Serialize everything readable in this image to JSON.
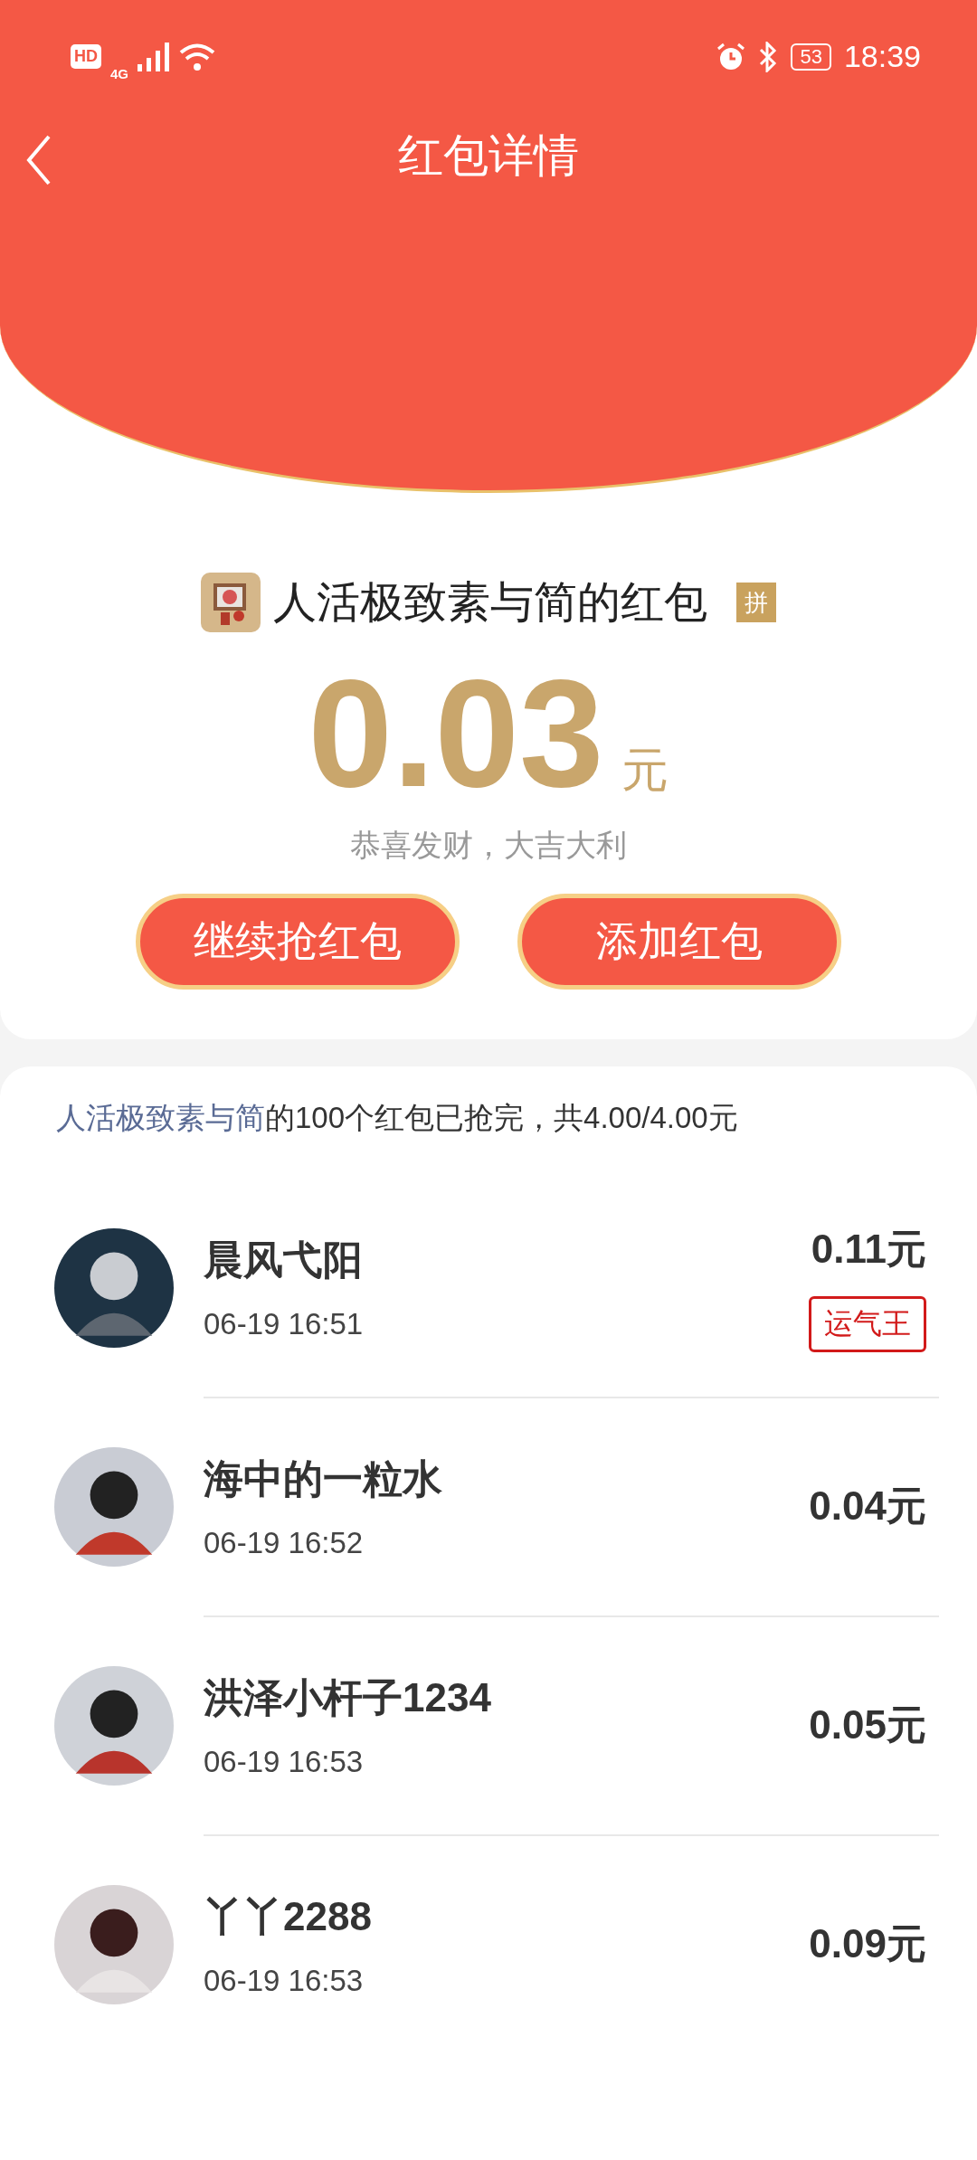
{
  "status_bar": {
    "hd": "HD",
    "network": "4G",
    "battery": "53",
    "time": "18:39"
  },
  "header": {
    "title": "红包详情"
  },
  "sender": {
    "title": "人活极致素与简的红包",
    "tag": "拼"
  },
  "amount": {
    "value": "0.03",
    "unit": "元"
  },
  "greeting": "恭喜发财，大吉大利",
  "buttons": [
    "继续抢红包",
    "添加红包"
  ],
  "summary": {
    "sender_name": "人活极致素与简",
    "text": "的100个红包已抢完，共4.00/4.00元"
  },
  "rows": [
    {
      "name": "晨风弋阳",
      "time": "06-19 16:51",
      "amount": "0.11元",
      "badge": "运气王"
    },
    {
      "name": "海中的一粒水",
      "time": "06-19 16:52",
      "amount": "0.04元"
    },
    {
      "name": "洪泽小杆子1234",
      "time": "06-19 16:53",
      "amount": "0.05元"
    },
    {
      "name": "丫丫2288",
      "time": "06-19 16:53",
      "amount": "0.09元"
    }
  ]
}
